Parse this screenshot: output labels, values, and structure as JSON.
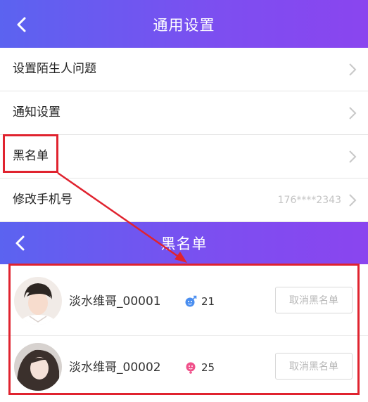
{
  "settings": {
    "title": "通用设置",
    "items": [
      {
        "label": "设置陌生人问题",
        "value": ""
      },
      {
        "label": "通知设置",
        "value": ""
      },
      {
        "label": "黑名单",
        "value": ""
      },
      {
        "label": "修改手机号",
        "value": "176****2343"
      }
    ]
  },
  "blacklist": {
    "title": "黑名单",
    "users": [
      {
        "name": "淡水维哥_00001",
        "gender": "male",
        "age": "21",
        "action": "取消黑名单"
      },
      {
        "name": "淡水维哥_00002",
        "gender": "female",
        "age": "25",
        "action": "取消黑名单"
      }
    ]
  },
  "colors": {
    "header_gradient_start": "#5b63f0",
    "header_gradient_end": "#8a45ef",
    "highlight": "#e0232f",
    "male": "#4a8ef0",
    "female": "#f0508a"
  }
}
